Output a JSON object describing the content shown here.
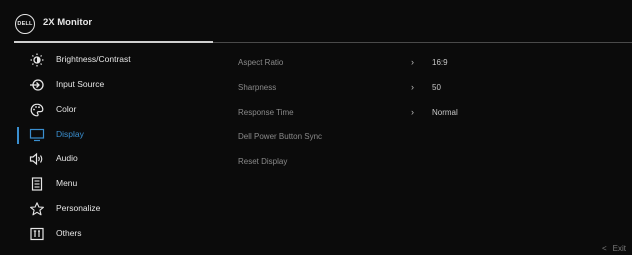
{
  "header": {
    "logo_text": "DELL",
    "title": "2X Monitor"
  },
  "sidebar": {
    "items": [
      {
        "label": "Brightness/Contrast",
        "icon": "brightness-icon"
      },
      {
        "label": "Input Source",
        "icon": "input-source-icon"
      },
      {
        "label": "Color",
        "icon": "color-palette-icon"
      },
      {
        "label": "Display",
        "icon": "display-monitor-icon",
        "active": true
      },
      {
        "label": "Audio",
        "icon": "speaker-icon"
      },
      {
        "label": "Menu",
        "icon": "menu-document-icon"
      },
      {
        "label": "Personalize",
        "icon": "star-icon"
      },
      {
        "label": "Others",
        "icon": "others-info-icon"
      }
    ]
  },
  "main": {
    "options": [
      {
        "label": "Aspect Ratio",
        "value": "16:9",
        "has_submenu": true
      },
      {
        "label": "Sharpness",
        "value": "50",
        "has_submenu": true
      },
      {
        "label": "Response Time",
        "value": "Normal",
        "has_submenu": true
      },
      {
        "label": "Dell Power Button Sync",
        "value": "",
        "has_submenu": false
      },
      {
        "label": "Reset Display",
        "value": "",
        "has_submenu": false
      }
    ]
  },
  "footer": {
    "exit_label": "Exit",
    "exit_arrow": "<"
  },
  "colors": {
    "accent": "#3a8fd0",
    "background": "#0b0b0b",
    "text": "#e6e6e6",
    "dim_text": "#8a8a8a"
  }
}
